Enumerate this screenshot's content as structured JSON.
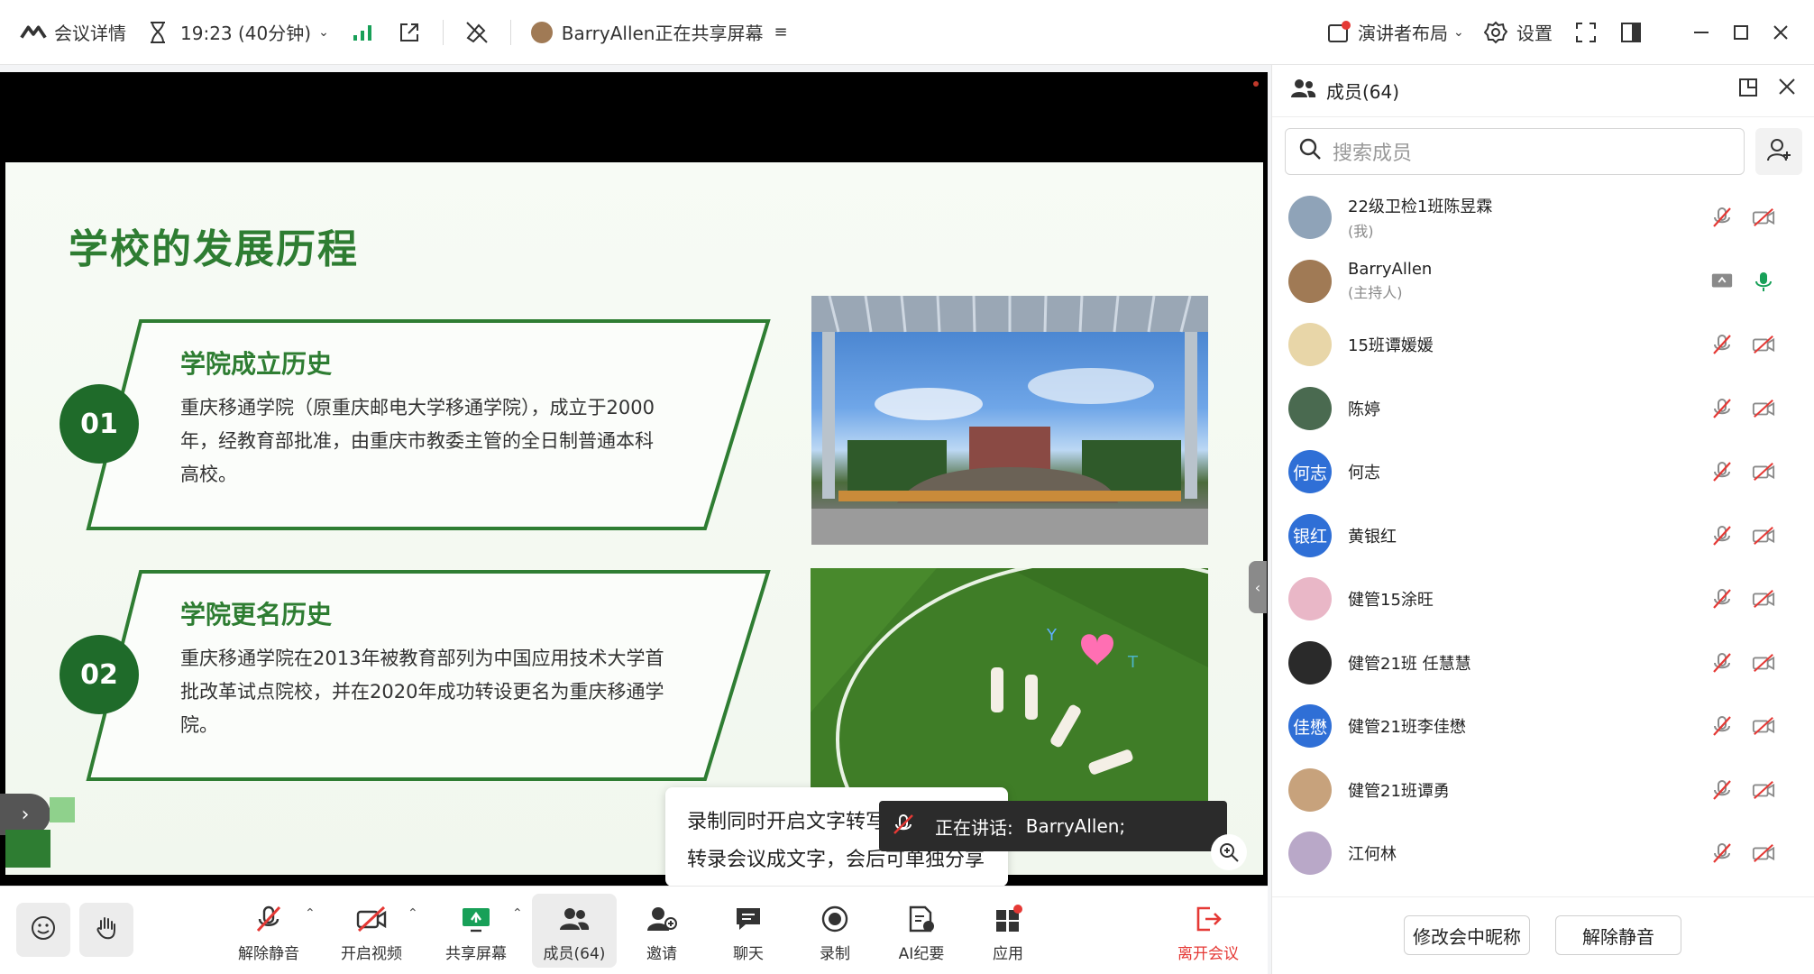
{
  "topbar": {
    "meeting_details": "会议详情",
    "timer": "19:23 (40分钟)",
    "sharing_text": "BarryAllen正在共享屏幕",
    "layout": "演讲者布局",
    "settings": "设置"
  },
  "slide": {
    "title": "学校的发展历程",
    "cards": [
      {
        "num": "01",
        "head": "学院成立历史",
        "body": "重庆移通学院（原重庆邮电大学移通学院），成立于2000年，经教育部批准，由重庆市教委主管的全日制普通本科高校。"
      },
      {
        "num": "02",
        "head": "学院更名历史",
        "body": "重庆移通学院在2013年被教育部列为中国应用技术大学首批改革试点院校，并在2020年成功转设更名为重庆移通学院。"
      }
    ]
  },
  "toast": {
    "line1": "录制同时开启文字转写",
    "line2": "转录会议成文字，会后可单独分享"
  },
  "speaking": {
    "label": "正在讲话:",
    "name": "BarryAllen;"
  },
  "toolbar": {
    "unmute": "解除静音",
    "start_video": "开启视频",
    "share_screen": "共享屏幕",
    "members": "成员(64)",
    "invite": "邀请",
    "chat": "聊天",
    "record": "录制",
    "ai_minutes": "AI纪要",
    "apps": "应用",
    "leave": "离开会议"
  },
  "panel": {
    "title": "成员(64)",
    "search_placeholder": "搜索成员",
    "members": [
      {
        "name": "22级卫检1班陈昱霖",
        "role": "(我)",
        "avatar_color": "#8fa3b8",
        "avatar_text": ""
      },
      {
        "name": "BarryAllen",
        "role": "(主持人)",
        "avatar_color": "#a07a55",
        "avatar_text": ""
      },
      {
        "name": "15班谭媛媛",
        "role": "",
        "avatar_color": "#e8d6a8",
        "avatar_text": ""
      },
      {
        "name": "陈婷",
        "role": "",
        "avatar_color": "#4a6a50",
        "avatar_text": ""
      },
      {
        "name": "何志",
        "role": "",
        "avatar_color": "#2f6fd6",
        "avatar_text": "何志"
      },
      {
        "name": "黄银红",
        "role": "",
        "avatar_color": "#2f6fd6",
        "avatar_text": "银红"
      },
      {
        "name": "健管15涂旺",
        "role": "",
        "avatar_color": "#e9b7c7",
        "avatar_text": ""
      },
      {
        "name": "健管21班 任慧慧",
        "role": "",
        "avatar_color": "#2a2a2a",
        "avatar_text": ""
      },
      {
        "name": "健管21班李佳懋",
        "role": "",
        "avatar_color": "#2f6fd6",
        "avatar_text": "佳懋"
      },
      {
        "name": "健管21班谭勇",
        "role": "",
        "avatar_color": "#c7a27c",
        "avatar_text": ""
      },
      {
        "name": "江何林",
        "role": "",
        "avatar_color": "#b9a8c8",
        "avatar_text": ""
      }
    ],
    "rename_button": "修改会中昵称",
    "unmute_button": "解除静音"
  },
  "colors": {
    "brand_green": "#2e7d32",
    "accent_red": "#e53935",
    "share_green": "#18a058"
  }
}
